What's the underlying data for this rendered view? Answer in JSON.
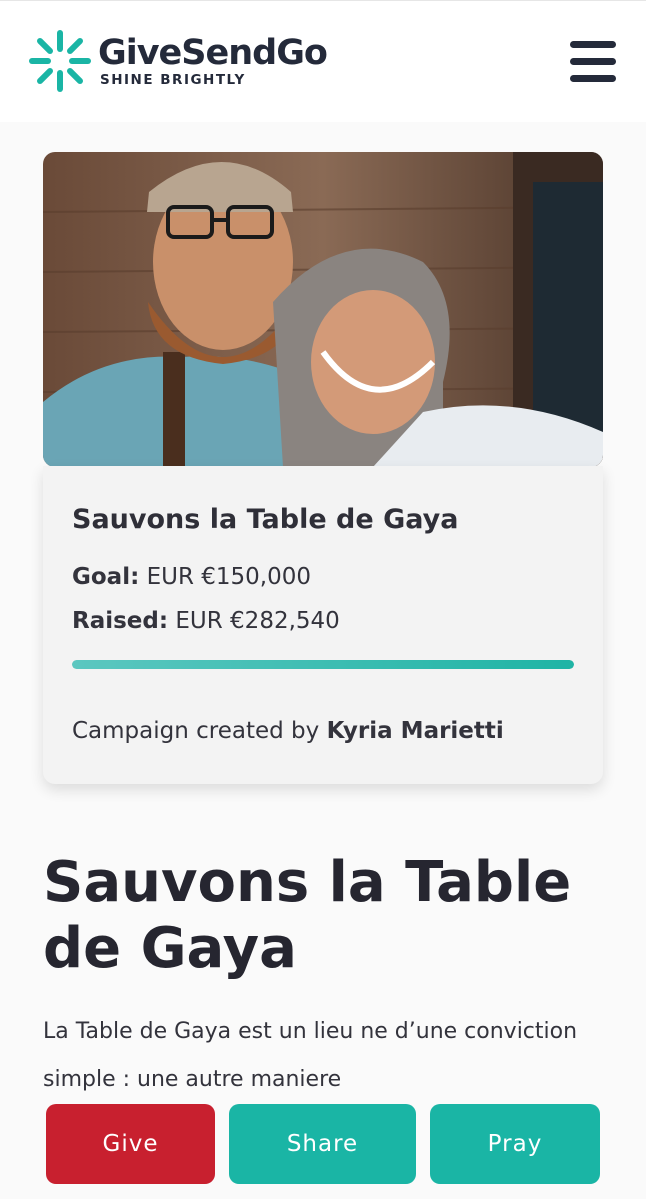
{
  "brand": {
    "name": "GiveSendGo",
    "tagline": "SHINE BRIGHTLY",
    "accent_color": "#1ab5a5",
    "give_color": "#c8202f"
  },
  "header": {
    "menu_icon": "hamburger-menu-icon"
  },
  "campaign": {
    "card_title": "Sauvons la Table de Gaya",
    "goal_label": "Goal:",
    "goal_value": "EUR €150,000",
    "raised_label": "Raised:",
    "raised_value": "EUR €282,540",
    "progress_fraction": 1.0,
    "creator_prefix": "Campaign created by",
    "creator_name": "Kyria Marietti"
  },
  "main": {
    "title": "Sauvons la Table de Gaya",
    "description": "La Table de Gaya est un lieu ne d’une conviction simple : une autre maniere"
  },
  "actions": {
    "give_label": "Give",
    "share_label": "Share",
    "pray_label": "Pray"
  }
}
